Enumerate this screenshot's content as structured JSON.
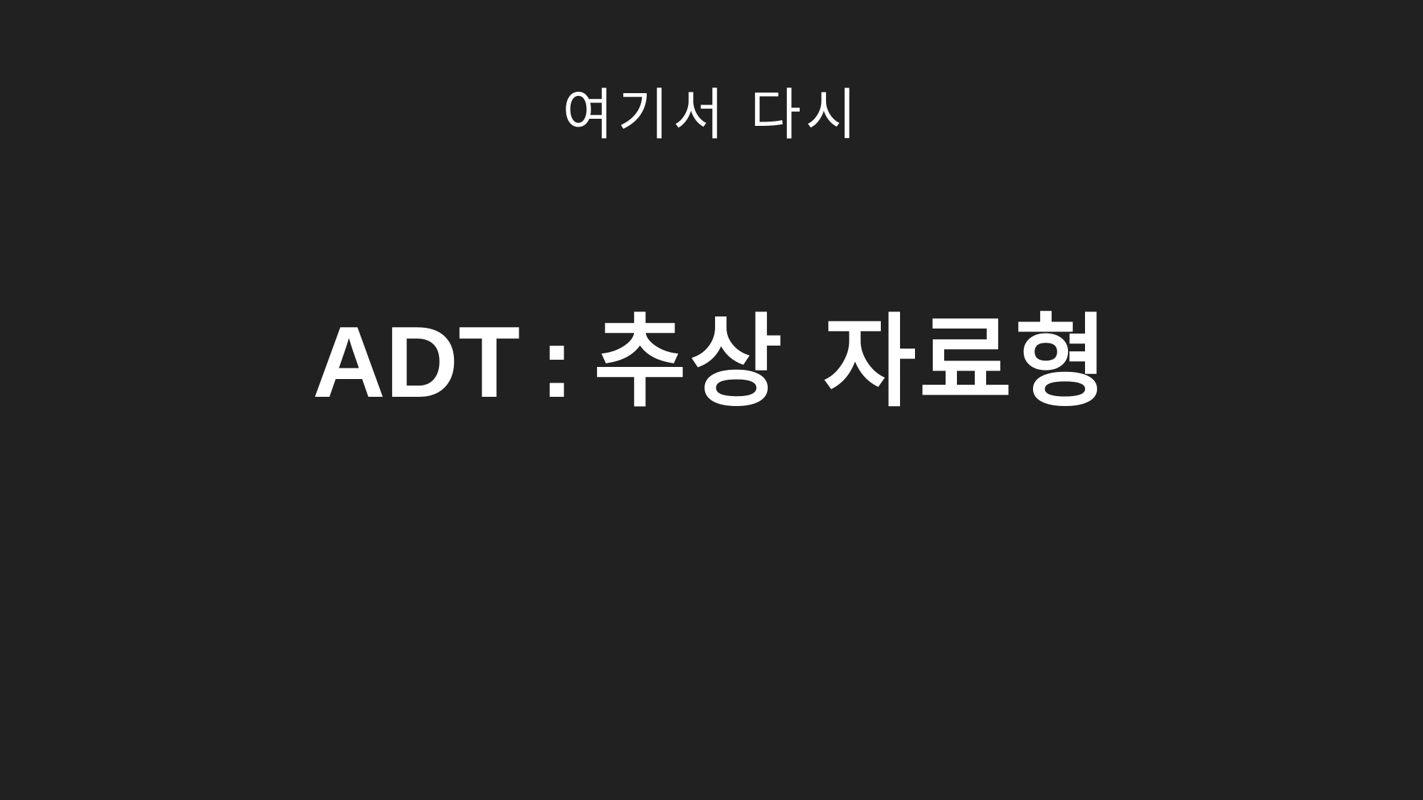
{
  "slide": {
    "subtitle": "여기서 다시",
    "title_abbr": "ADT",
    "title_separator": ":",
    "title_korean": "추상 자료형"
  },
  "colors": {
    "background": "#212121",
    "text": "#ffffff"
  }
}
